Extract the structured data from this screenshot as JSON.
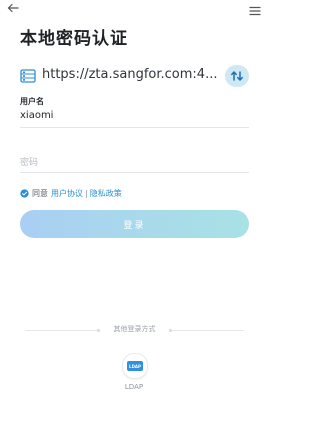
{
  "page": {
    "title": "本地密码认证"
  },
  "server": {
    "url": "https://zta.sangfor.com:4...",
    "icon": "server-list-icon",
    "switch_icon": "switch-server-icon"
  },
  "form": {
    "username_label": "用户名",
    "username_value": "xiaomi",
    "password_placeholder": "密码"
  },
  "agreement": {
    "prefix": "同意",
    "user_agreement": "用户协议",
    "separator": "|",
    "privacy_policy": "隐私政策"
  },
  "login": {
    "label": "登录"
  },
  "other_login": {
    "label": "其他登录方式",
    "methods": [
      {
        "label": "LDAP",
        "badge": "LDAP",
        "icon": "ldap-icon"
      }
    ]
  },
  "colors": {
    "accent": "#2c8fd6",
    "login_gradient_start": "#a9cff4",
    "login_gradient_end": "#a8e2e4",
    "switch_bg": "#cfe9f4"
  }
}
